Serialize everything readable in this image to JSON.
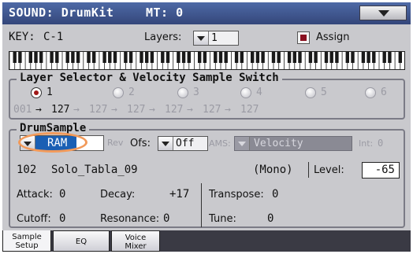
{
  "title": {
    "section": "SOUND: DrumKit",
    "mt": "MT: 0"
  },
  "key": {
    "label": "KEY:",
    "value": "C-1"
  },
  "layers": {
    "label": "Layers:",
    "value": "1"
  },
  "assign": {
    "label": "Assign",
    "checked": true
  },
  "layer_selector": {
    "title": "Layer Selector & Velocity Sample Switch",
    "layers": [
      {
        "num": "1",
        "selected": true,
        "from": "001",
        "to": "127"
      },
      {
        "num": "2",
        "selected": false,
        "from": "127",
        "to": "127"
      },
      {
        "num": "3",
        "selected": false,
        "from": "127",
        "to": "127"
      },
      {
        "num": "4",
        "selected": false,
        "from": "127",
        "to": "127"
      },
      {
        "num": "5",
        "selected": false,
        "from": "127",
        "to": "127"
      },
      {
        "num": "6",
        "selected": false,
        "from": "127",
        "to": "127"
      }
    ]
  },
  "drum_sample": {
    "title": "DrumSample",
    "bank": "RAM",
    "rev_label": "Rev",
    "ofs_label": "Ofs:",
    "ofs_value": "Off",
    "ams_label": "AMS:",
    "ams_value": "Velocity",
    "int_label": "Int:",
    "int_value": "0",
    "sample_number": "102",
    "sample_name": "Solo_Tabla_09",
    "mode": "(Mono)",
    "level_label": "Level:",
    "level_value": "-65",
    "attack_label": "Attack:",
    "attack_value": "0",
    "decay_label": "Decay:",
    "decay_value": "+17",
    "transpose_label": "Transpose:",
    "transpose_value": "0",
    "cutoff_label": "Cutoff:",
    "cutoff_value": "0",
    "resonance_label": "Resonance:",
    "resonance_value": "0",
    "tune_label": "Tune:",
    "tune_value": "0"
  },
  "tabs": [
    {
      "line1": "Sample",
      "line2": "Setup",
      "active": true
    },
    {
      "line1": "EQ",
      "line2": "",
      "active": false
    },
    {
      "line1": "Voice",
      "line2": "Mixer",
      "active": false
    }
  ],
  "colors": {
    "title_bar": "#34467a",
    "selection": "#1a5fb4",
    "highlight_oval": "#f29a5a",
    "assign_check": "#8a1020",
    "radio_on": "#a01818"
  }
}
